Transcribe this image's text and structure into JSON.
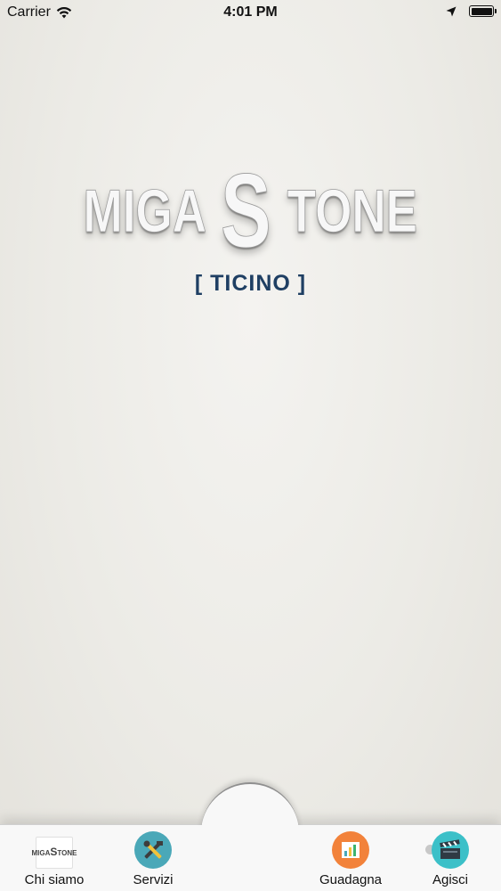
{
  "status_bar": {
    "carrier": "Carrier",
    "time": "4:01 PM"
  },
  "logo": {
    "left": "MIGA",
    "big_s": "S",
    "right": "TONE"
  },
  "region_label": "[ TICINO ]",
  "tabs": [
    {
      "label": "Chi siamo",
      "icon": "migastone-logo-icon"
    },
    {
      "label": "Servizi",
      "icon": "tools-icon"
    },
    {
      "label": "Guadagna",
      "icon": "chart-icon"
    },
    {
      "label": "Agisci",
      "icon": "clapperboard-icon"
    }
  ],
  "colors": {
    "region": "#1f3f63",
    "servizi": "#4aa8b8",
    "guadagna": "#f2823a",
    "agisci": "#3cc0c8"
  }
}
